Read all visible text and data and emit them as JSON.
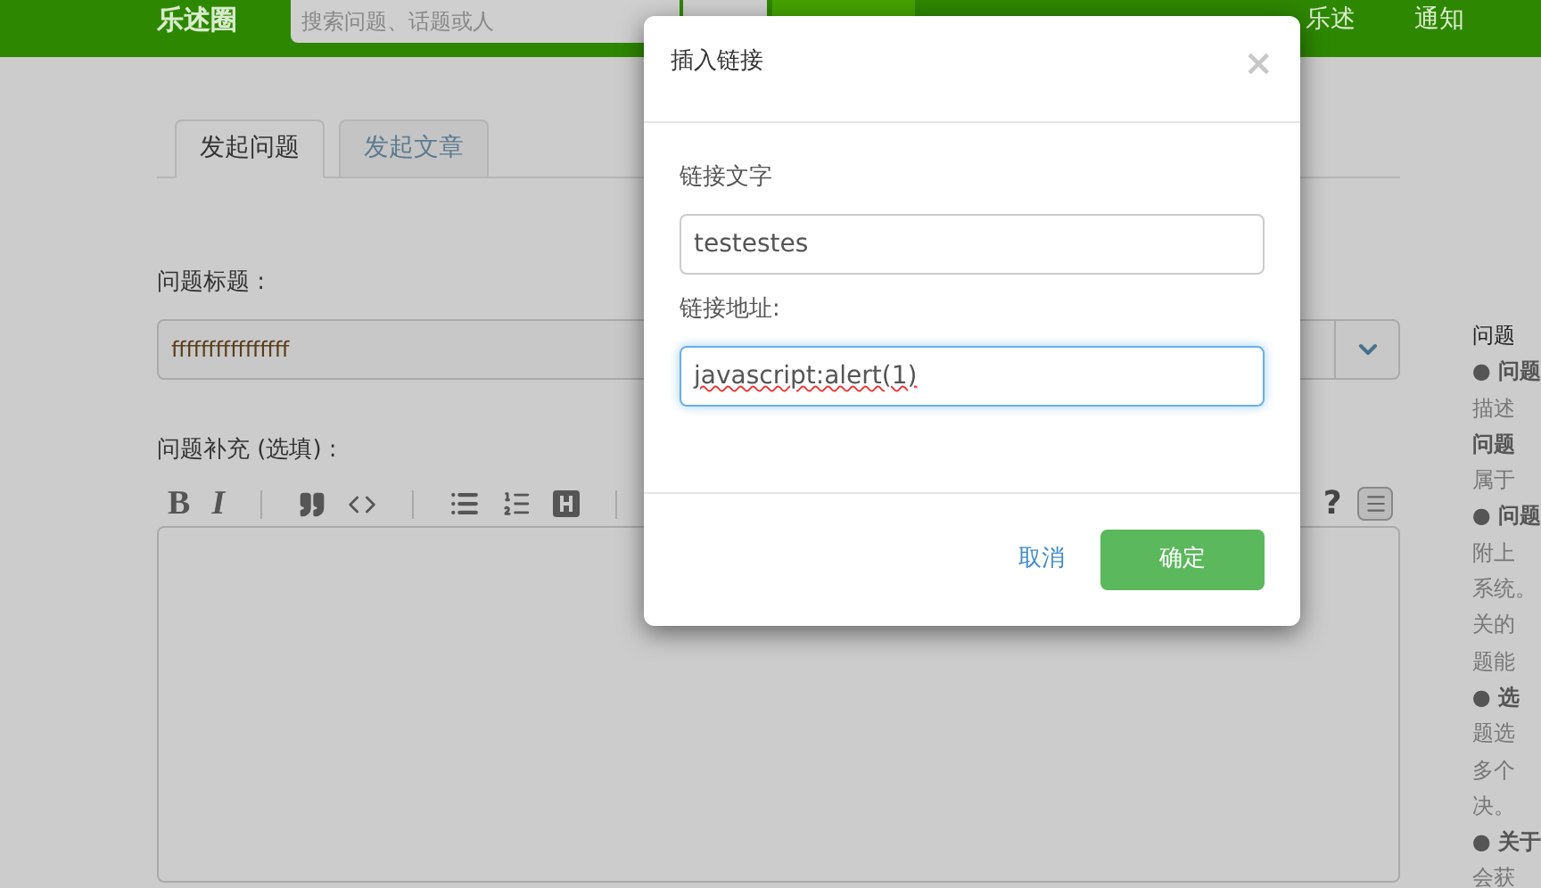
{
  "header": {
    "logo": "乐述圈",
    "search": {
      "placeholder": "搜索问题、话题或人"
    },
    "nav": [
      {
        "label": "乐述"
      },
      {
        "label": "通知"
      }
    ]
  },
  "tabs": [
    {
      "label": "发起问题",
      "selected": true
    },
    {
      "label": "发起文章",
      "selected": false
    }
  ],
  "title_field": {
    "label": "问题标题 :",
    "value": "ffffffffffffffff"
  },
  "detail": {
    "label": "问题补充 (选填) :",
    "toolbar": [
      {
        "kind": "bold",
        "label": "B"
      },
      {
        "kind": "italic",
        "label": "I"
      },
      {
        "kind": "sep"
      },
      {
        "kind": "quote"
      },
      {
        "kind": "code"
      },
      {
        "kind": "sep"
      },
      {
        "kind": "ul"
      },
      {
        "kind": "ol"
      },
      {
        "kind": "heading"
      },
      {
        "kind": "sep"
      }
    ],
    "toolbar_right": [
      {
        "kind": "help",
        "label": "?"
      },
      {
        "kind": "menu"
      }
    ]
  },
  "sidebar": {
    "lines": [
      {
        "kind": "heading",
        "text": "问题"
      },
      {
        "kind": "bold",
        "text": "● 问题"
      },
      {
        "kind": "text",
        "text": "描述"
      },
      {
        "kind": "bold",
        "text": "问题"
      },
      {
        "kind": "text",
        "text": "属于"
      },
      {
        "kind": "bold",
        "text": "● 问题"
      },
      {
        "kind": "text",
        "text": "附上"
      },
      {
        "kind": "text",
        "text": "系统。"
      },
      {
        "kind": "text",
        "text": "关的"
      },
      {
        "kind": "text",
        "text": "题能"
      },
      {
        "kind": "bold",
        "text": "● 选"
      },
      {
        "kind": "text",
        "text": "题选"
      },
      {
        "kind": "text",
        "text": "多个"
      },
      {
        "kind": "text",
        "text": "决。"
      },
      {
        "kind": "bold",
        "text": "● 关于"
      },
      {
        "kind": "text",
        "text": "会获"
      }
    ]
  },
  "dialog": {
    "title": "插入链接",
    "close": "×",
    "fields": [
      {
        "label": "链接文字",
        "value": "testestes",
        "focused": false
      },
      {
        "label": "链接地址:",
        "value": "javascript:alert(1)",
        "focused": true
      }
    ],
    "cancel": "取消",
    "confirm": "确定"
  }
}
